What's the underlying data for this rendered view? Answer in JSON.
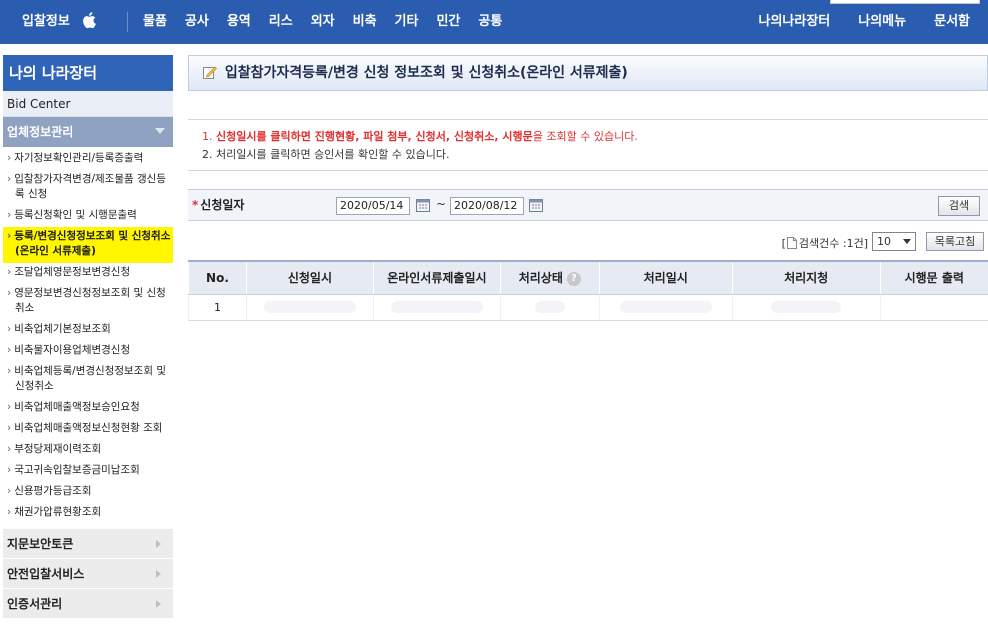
{
  "topnav": {
    "brand": "입찰정보",
    "left_items": [
      "물품",
      "공사",
      "용역",
      "리스",
      "외자",
      "비축",
      "기타",
      "민간",
      "공통"
    ],
    "right_items": [
      "나의나라장터",
      "나의메뉴",
      "문서함"
    ]
  },
  "sidebar": {
    "title": "나의 나라장터",
    "bid_center": "Bid Center",
    "category": "업체정보관리",
    "items": [
      "자기정보확인관리/등록증출력",
      "입찰참가자격변경/제조물품 갱신등록 신청",
      "등록신청확인 및 시행문출력",
      "등록/변경신청정보조회 및 신청취소(온라인 서류제출)",
      "조달업체영문정보변경신청",
      "영문정보변경신청정보조회 및 신청취소",
      "비축업체기본정보조회",
      "비축물자이용업체변경신청",
      "비축업체등록/변경신청정보조회 및 신청취소",
      "비축업체매출액정보승인요청",
      "비축업체매출액정보신청현황 조회",
      "부정당제재이력조회",
      "국고귀속입찰보증금미납조회",
      "신용평가등급조회",
      "채권가압류현황조회"
    ],
    "active_index": 3,
    "bottom_items": [
      "지문보안토큰",
      "안전입찰서비스",
      "인증서관리"
    ]
  },
  "page": {
    "title": "입찰참가자격등록/변경 신청 정보조회 및 신청취소(온라인 서류제출)",
    "notice_1_prefix": "1. ",
    "notice_1_em1": "신청일시를 클릭하면 진행현황, 파일 첨부, 신청서, 신청취소, 시행문",
    "notice_1_suffix": "을 조회할 수 있습니다.",
    "notice_2": "2. 처리일시를 클릭하면 승인서를 확인할 수 있습니다."
  },
  "search": {
    "label": "신청일자",
    "date_from": "2020/05/14",
    "date_to": "2020/08/12",
    "tilde": "~",
    "button": "검색"
  },
  "list": {
    "count_prefix": "[",
    "count_text": "검색건수 :1건]",
    "page_size": "10",
    "refresh_button": "목록고침"
  },
  "table": {
    "headers": [
      "No.",
      "신청일시",
      "온라인서류제출일시",
      "처리상태",
      "처리일시",
      "처리지청",
      "시행문 출력"
    ],
    "rows": [
      {
        "no": "1"
      }
    ]
  },
  "colors": {
    "nav_bg": "#2a5db0",
    "sidebar_head": "#2f64b8",
    "highlight": "#fff600",
    "notice_red": "#e03030"
  }
}
